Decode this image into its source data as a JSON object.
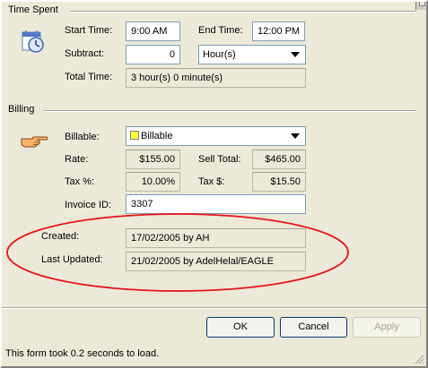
{
  "time_spent": {
    "section_title": "Time Spent",
    "clock_icon": "clock-calendar-icon",
    "start_time_label": "Start Time:",
    "start_time_value": "9:00 AM",
    "end_time_label": "End Time:",
    "end_time_value": "12:00 PM",
    "subtract_label": "Subtract:",
    "subtract_value": "0",
    "subtract_unit": "Hour(s)",
    "total_time_label": "Total Time:",
    "total_time_value": "3 hour(s) 0 minute(s)"
  },
  "billing": {
    "section_title": "Billing",
    "hand_icon": "pointing-hand-icon",
    "billable_label": "Billable:",
    "billable_value": "Billable",
    "billable_color": "#ffff33",
    "rate_label": "Rate:",
    "rate_value": "$155.00",
    "sell_total_label": "Sell Total:",
    "sell_total_value": "$465.00",
    "tax_pct_label": "Tax %:",
    "tax_pct_value": "10.00%",
    "tax_amount_label": "Tax $:",
    "tax_amount_value": "$15.50",
    "invoice_label": "Invoice ID:",
    "invoice_value": "3307"
  },
  "audit": {
    "created_label": "Created:",
    "created_value": "17/02/2005 by AH",
    "updated_label": "Last Updated:",
    "updated_value": "21/02/2005 by AdelHelal/EAGLE",
    "highlight_color": "#e8141a"
  },
  "buttons": {
    "ok": "OK",
    "cancel": "Cancel",
    "apply": "Apply"
  },
  "status_bar": {
    "text": "This form took 0.2 seconds to load."
  }
}
